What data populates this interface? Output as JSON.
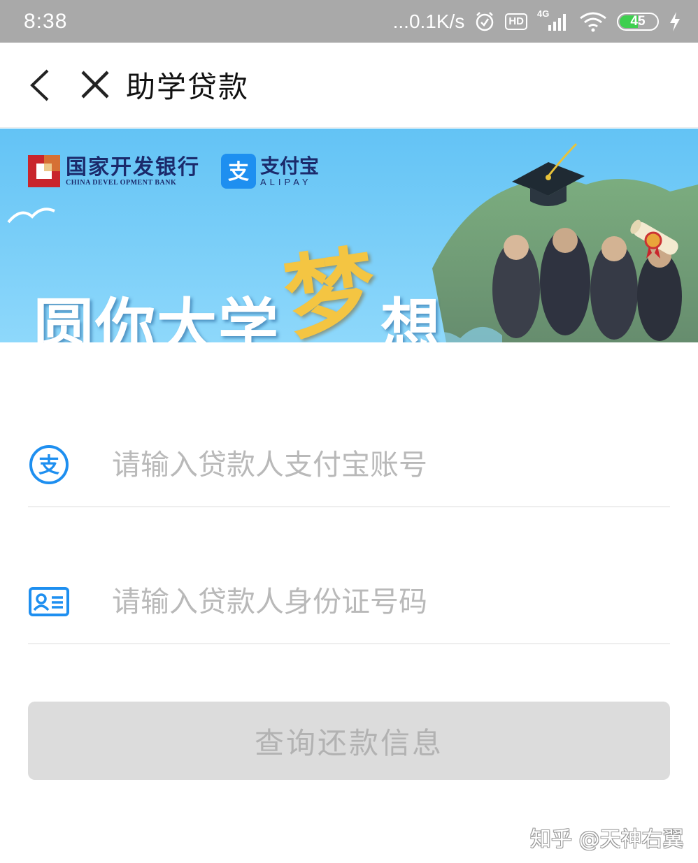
{
  "status_bar": {
    "time": "8:38",
    "network_speed": "...0.1K/s",
    "hd_badge": "HD",
    "signal_type": "4G",
    "battery_level": "45",
    "battery_fill_color": "#3ecf4f",
    "icons": [
      "alarm-icon",
      "hd-icon",
      "signal-icon",
      "wifi-icon",
      "battery-icon",
      "charging-icon"
    ]
  },
  "nav": {
    "title": "助学贷款",
    "back_icon": "chevron-left-icon",
    "close_icon": "close-icon"
  },
  "banner": {
    "bank_name": "国家开发银行",
    "bank_name_en": "CHINA DEVEL OPMENT BANK",
    "alipay_name": "支付宝",
    "alipay_name_en": "ALIPAY",
    "slogan_part1": "圆你大学",
    "slogan_highlight": "梦",
    "slogan_part2": "想"
  },
  "form": {
    "alipay_account": {
      "placeholder": "请输入贷款人支付宝账号",
      "value": "",
      "icon": "alipay-icon"
    },
    "id_number": {
      "placeholder": "请输入贷款人身份证号码",
      "value": "",
      "icon": "id-card-icon"
    },
    "submit_label": "查询还款信息"
  },
  "watermark": "知乎 @天神右翼",
  "colors": {
    "accent_blue": "#1e8ff0",
    "button_disabled_bg": "#dcdcdc",
    "button_disabled_text": "#b2b2b2"
  }
}
